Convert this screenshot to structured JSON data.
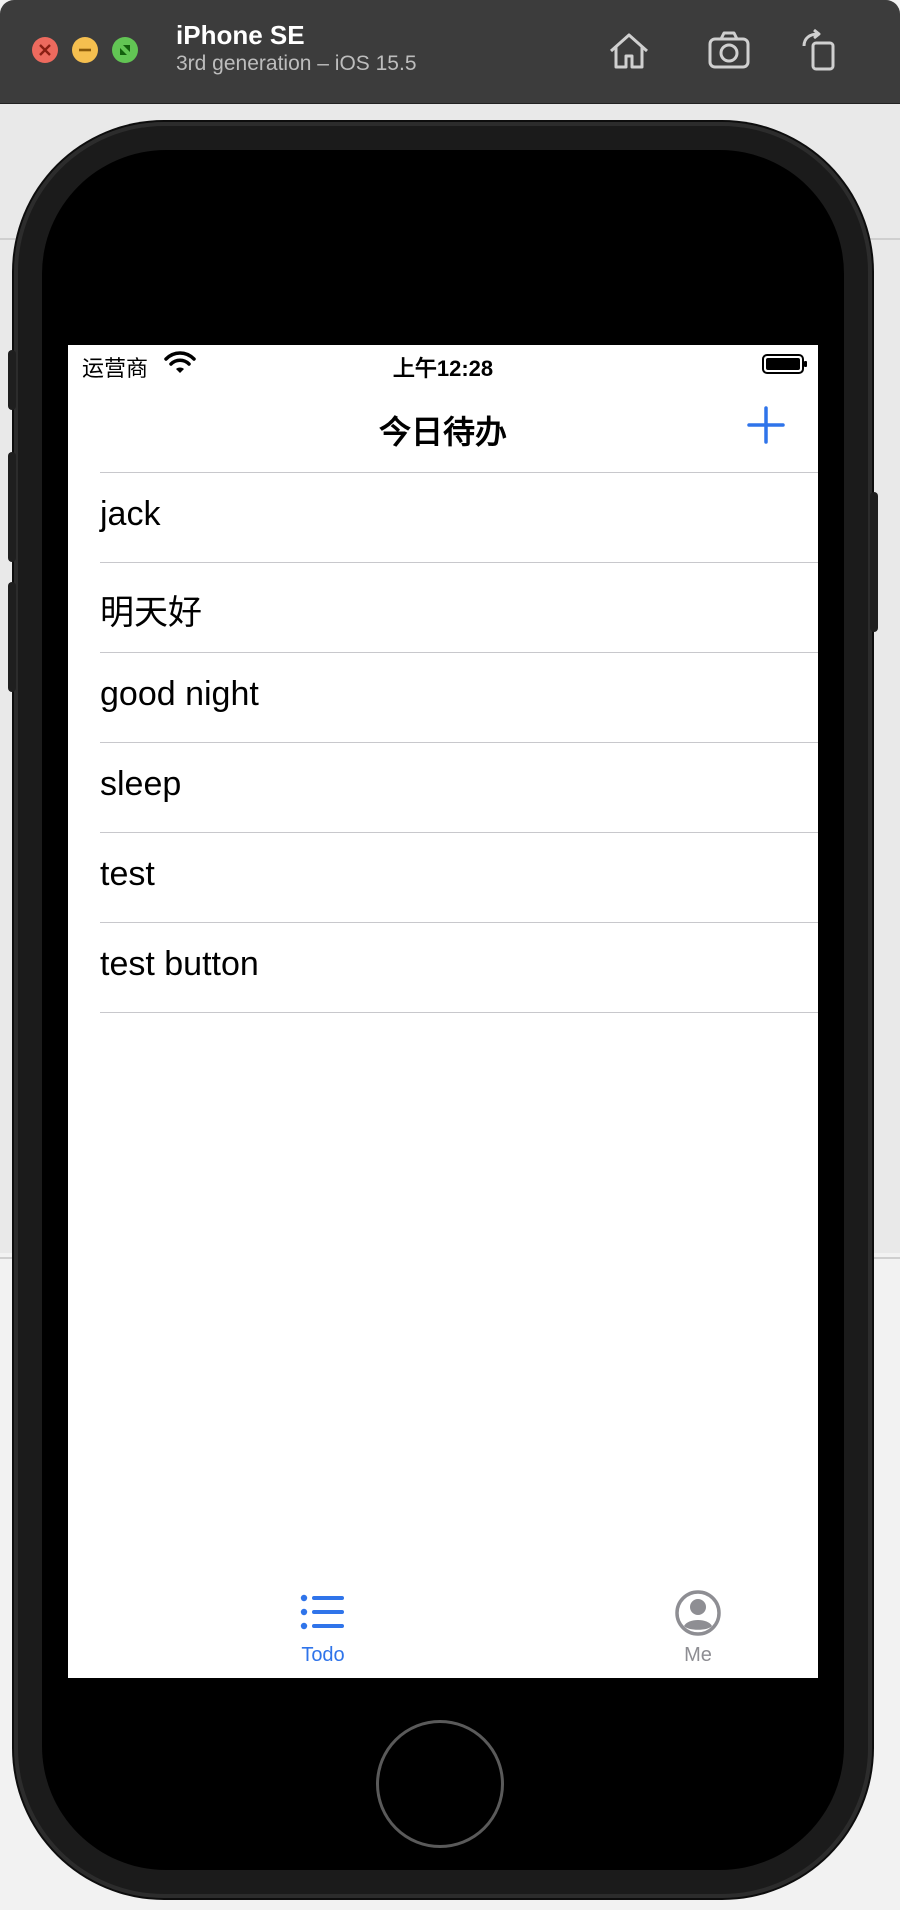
{
  "simulator": {
    "device_name": "iPhone SE",
    "device_subtitle": "3rd generation – iOS 15.5",
    "toolbar_icons": [
      "home-icon",
      "screenshot-icon",
      "rotate-icon"
    ]
  },
  "status_bar": {
    "carrier": "运营商",
    "time": "上午12:28"
  },
  "navigation": {
    "title": "今日待办",
    "add_icon": "plus-icon"
  },
  "todo_items": [
    {
      "label": "jack"
    },
    {
      "label": "明天好"
    },
    {
      "label": "good night"
    },
    {
      "label": "sleep"
    },
    {
      "label": "test"
    },
    {
      "label": "test button"
    }
  ],
  "tabs": [
    {
      "label": "Todo",
      "icon": "list-icon",
      "selected": true
    },
    {
      "label": "Me",
      "icon": "person-circle-icon",
      "selected": false
    }
  ],
  "colors": {
    "accent": "#2f74ea",
    "tab_inactive": "#8e8e93"
  }
}
